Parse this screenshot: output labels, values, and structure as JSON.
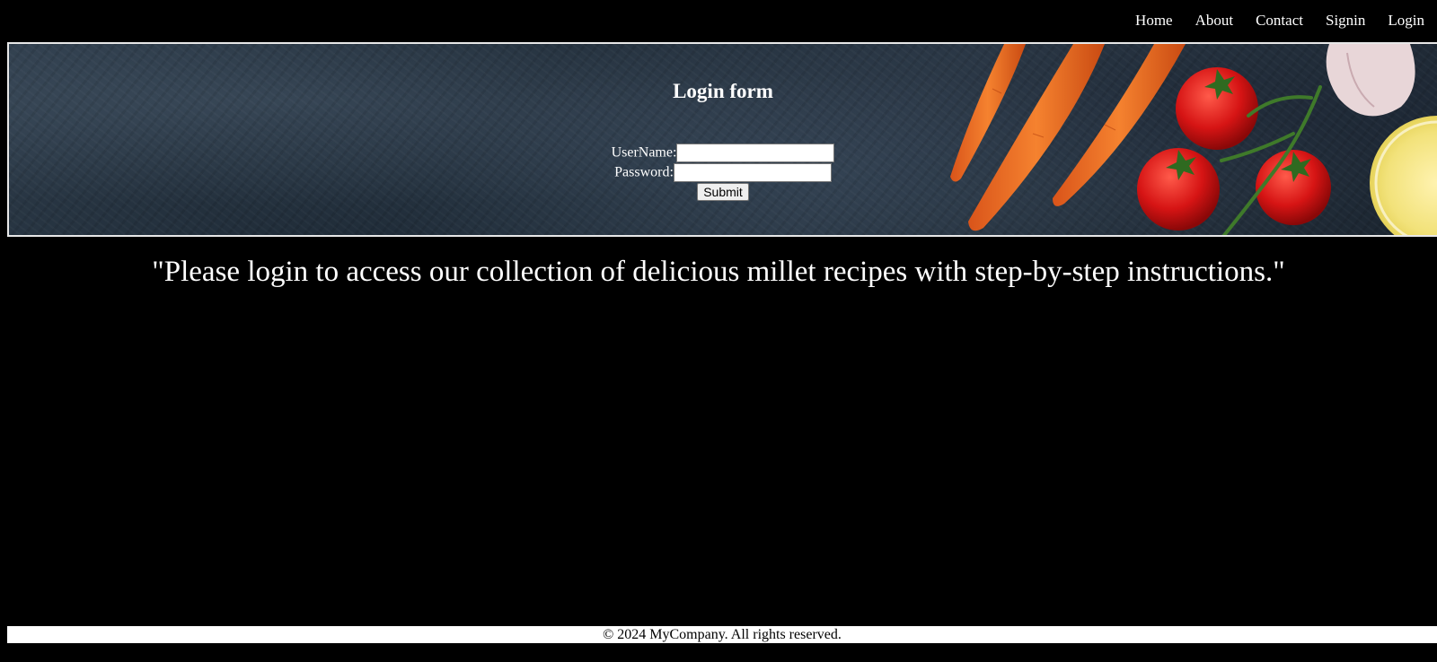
{
  "nav": {
    "items": [
      {
        "label": "Home"
      },
      {
        "label": "About"
      },
      {
        "label": "Contact"
      },
      {
        "label": "Signin"
      },
      {
        "label": "Login"
      }
    ]
  },
  "banner": {
    "image": "vegetables-carrots-tomatoes-garlic-lemon-on-dark-slate"
  },
  "login": {
    "title": "Login form",
    "username_label": "UserName:",
    "username_value": "",
    "password_label": "Password:",
    "password_value": "",
    "submit_label": "Submit"
  },
  "quote": "\"Please login to access our collection of delicious millet recipes with step-by-step instructions.\"",
  "footer": {
    "text": "© 2024 MyCompany. All rights reserved."
  }
}
